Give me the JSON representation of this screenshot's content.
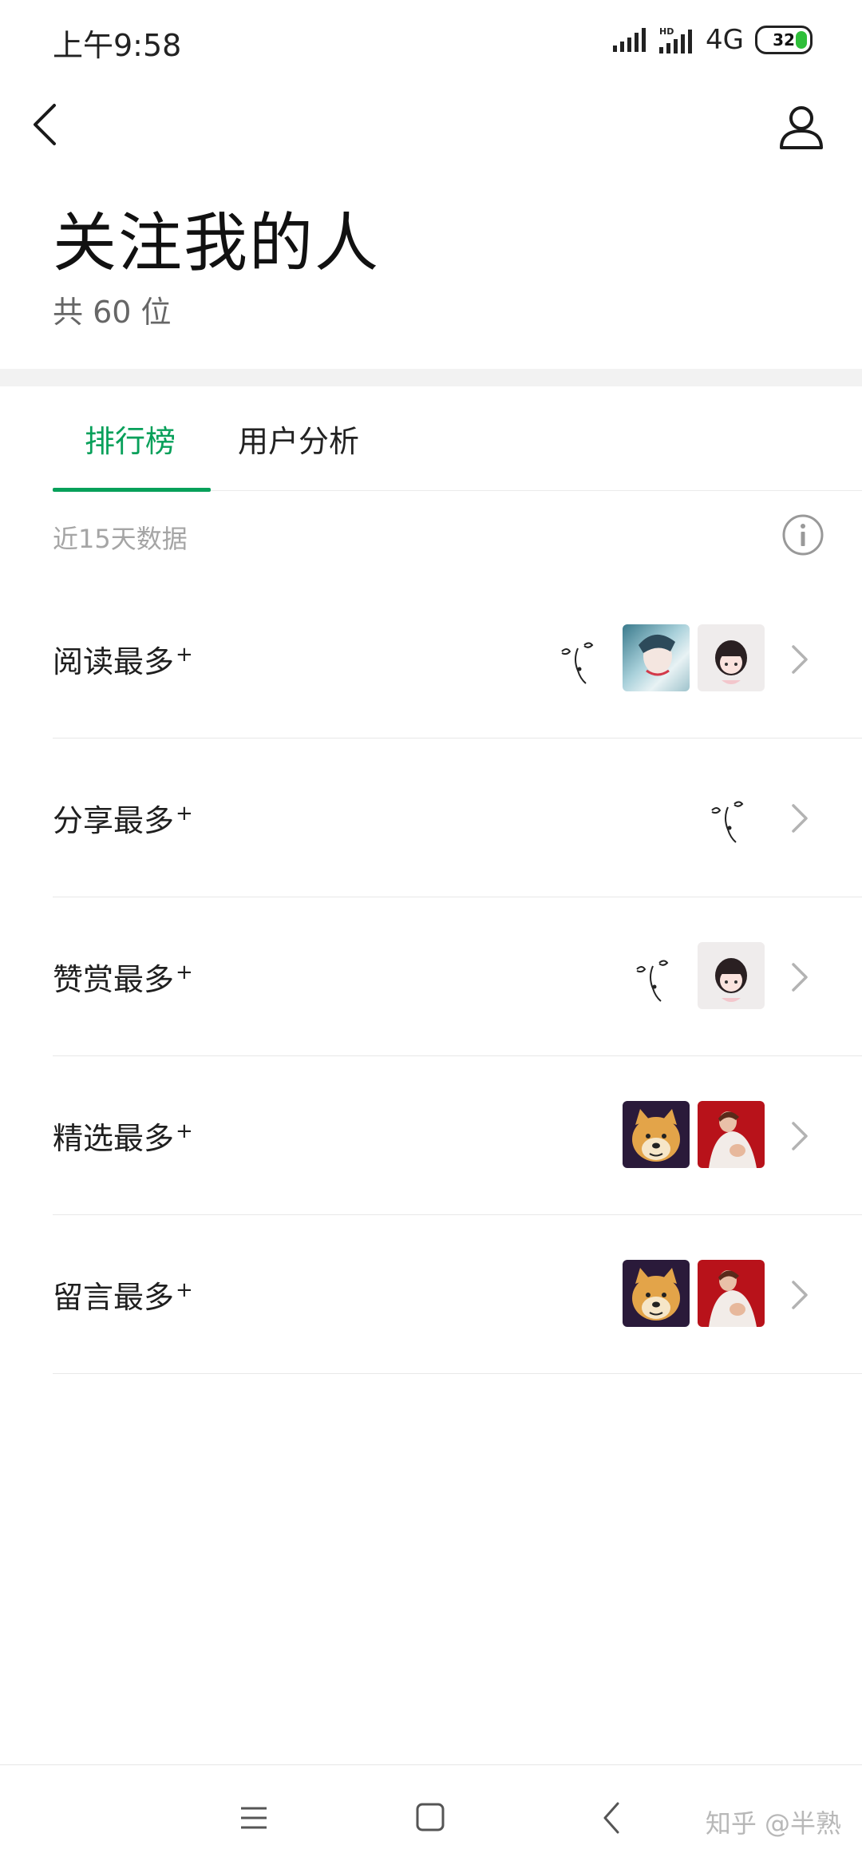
{
  "status_bar": {
    "time": "上午9:58",
    "network": "4G",
    "battery": "32"
  },
  "header": {
    "back_icon": "chevron-left-icon",
    "profile_icon": "user-icon",
    "title": "关注我的人",
    "count_text": "共 60 位"
  },
  "tabs": [
    {
      "label": "排行榜",
      "active": true
    },
    {
      "label": "用户分析",
      "active": false
    }
  ],
  "note": "近15天数据",
  "ranking": [
    {
      "label": "阅读最多",
      "avatars": [
        "face-sketch-avatar",
        "boy-avatar",
        "girl-avatar"
      ]
    },
    {
      "label": "分享最多",
      "avatars": [
        "face-sketch-avatar"
      ]
    },
    {
      "label": "赞赏最多",
      "avatars": [
        "face-sketch-avatar",
        "girl-avatar"
      ]
    },
    {
      "label": "精选最多",
      "avatars": [
        "doge-avatar",
        "woman-avatar"
      ]
    },
    {
      "label": "留言最多",
      "avatars": [
        "doge-avatar",
        "woman-avatar"
      ]
    }
  ],
  "rank_suffix": "+",
  "nav": {
    "menu_icon": "menu-icon",
    "home_icon": "square-icon",
    "back_icon": "back-icon"
  },
  "watermark": "知乎 @半熟",
  "colors": {
    "accent": "#07a05a",
    "divider_band": "#f2f2f2"
  }
}
